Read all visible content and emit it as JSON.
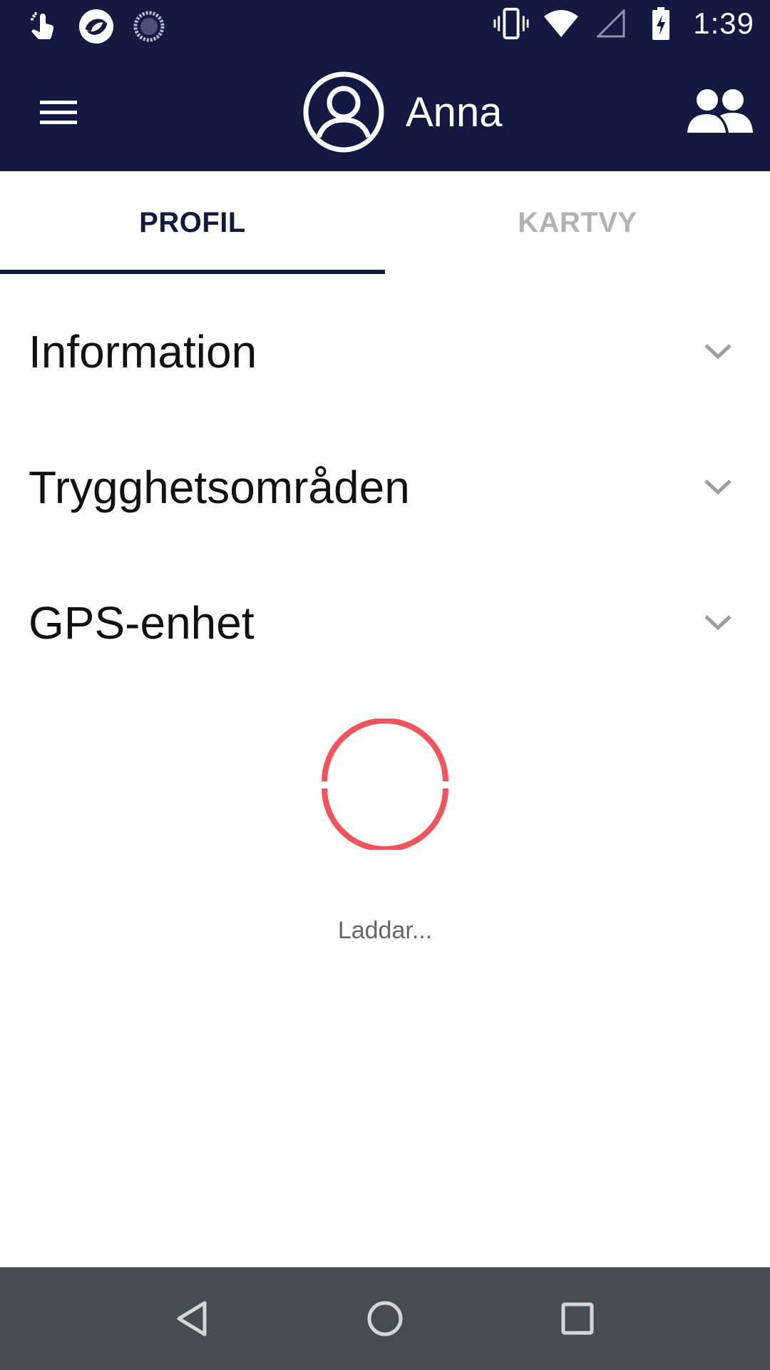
{
  "status_bar": {
    "time": "1:39",
    "left_icons": [
      "touch-app-icon",
      "app-logo-icon",
      "sync-icon"
    ],
    "right_icons": [
      "vibrate-icon",
      "wifi-icon",
      "signal-icon",
      "battery-charging-icon"
    ]
  },
  "app_bar": {
    "menu_icon": "hamburger-menu-icon",
    "profile_icon": "account-circle-icon",
    "user_name": "Anna",
    "group_icon": "group-icon",
    "background": "#131940"
  },
  "tabs": [
    {
      "label": "PROFIL",
      "active": true
    },
    {
      "label": "KARTVY",
      "active": false
    }
  ],
  "sections": [
    {
      "title": "Information"
    },
    {
      "title": "Trygghetsområden"
    },
    {
      "title": "GPS-enhet"
    }
  ],
  "loading": {
    "text": "Laddar...",
    "spinner_color": "#f2545b"
  },
  "nav_bar": {
    "buttons": [
      "back-icon",
      "home-icon",
      "recents-icon"
    ]
  }
}
